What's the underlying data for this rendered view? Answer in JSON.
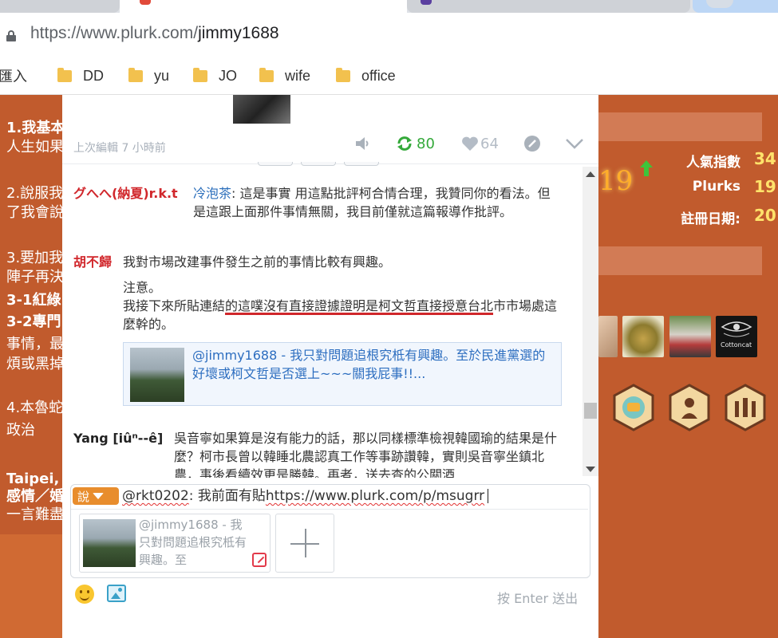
{
  "browser": {
    "url_host": "https://www.plurk.com/",
    "url_path": "jimmy1688",
    "bookmarks": [
      {
        "label": "匯入",
        "icon": "apps-icon"
      },
      {
        "label": "DD",
        "icon": "folder-icon"
      },
      {
        "label": "yu",
        "icon": "folder-icon"
      },
      {
        "label": "JO",
        "icon": "folder-icon"
      },
      {
        "label": "wife",
        "icon": "folder-icon"
      },
      {
        "label": "office",
        "icon": "folder-icon"
      }
    ]
  },
  "background_page": {
    "left_lines": [
      {
        "text": "1.我基本",
        "bold": true
      },
      {
        "text": "人生如果",
        "bold": false
      },
      {
        "text": "",
        "bold": false
      },
      {
        "text": "2.說服我",
        "bold": false
      },
      {
        "text": "了我會說",
        "bold": false
      },
      {
        "text": "",
        "bold": false
      },
      {
        "text": "3.要加我",
        "bold": false
      },
      {
        "text": "陣子再決",
        "bold": false
      },
      {
        "text": "3-1紅綠",
        "bold": true
      },
      {
        "text": "3-2專門",
        "bold": true
      },
      {
        "text": "事情，最",
        "bold": false
      },
      {
        "text": "煩或黑掉",
        "bold": false
      },
      {
        "text": "",
        "bold": false
      },
      {
        "text": "4.本魯蛇",
        "bold": false
      },
      {
        "text": "政治",
        "bold": false
      },
      {
        "text": "",
        "bold": false
      },
      {
        "text": "Taipei,",
        "bold": true
      },
      {
        "text": "感情／婚",
        "bold": true
      },
      {
        "text": "一言難盡",
        "bold": false
      }
    ],
    "karma": "19",
    "stats": [
      {
        "label": "人氣指數",
        "value": "34"
      },
      {
        "label": "Plurks",
        "value": "19"
      },
      {
        "label": "註冊日期:",
        "value": "20"
      }
    ],
    "friend_avatars": [
      "cat-avatar",
      "bird-avatar",
      "cyclists-avatar",
      "cottoncat-avatar"
    ],
    "friend_avatar_caption": "Cottoncat",
    "badges": [
      "chat-badge-icon",
      "keyhole-badge-icon",
      "group-badge-icon"
    ]
  },
  "plurk": {
    "edited_text": "上次編輯 7 小時前",
    "replurk_count": "80",
    "like_count": "64"
  },
  "responses": [
    {
      "author": "グへへ(納夏)r.k.t",
      "mention": "冷泡茶",
      "text": ": 這是事實 用這點批評柯合情合理，我贊同你的看法。但是這跟上面那件事情無關，我目前僅就這篇報導作批評。"
    },
    {
      "author": "胡不歸",
      "text": "我對市場改建事件發生之前的事情比較有興趣。",
      "note_line1": "注意。",
      "note_prefix": "我接下來所貼連結",
      "note_underlined": "的這噗沒有直接證據證明是柯文哲直接授意台北",
      "note_suffix": "市市場處這麼幹的。",
      "card_text": "@jimmy1688 - 我只對問題追根究柢有興趣。至於民進黨選的好壞或柯文哲是否選上~~~關我屁事!!..."
    },
    {
      "author": "Yang [iûⁿ--ê]",
      "text": "吳音寧如果算是沒有能力的話，那以同樣標準檢視韓國瑜的結果是什麼？柯市長曾以韓睡北農認真工作等事跡讚韓，實則吳音寧坐鎮北農，事後看續效更是勝韓。再者，送去查的公關酒"
    }
  ],
  "composer": {
    "qualifier": "說",
    "mention": "@rkt0202",
    "text_before_link": ": 我前面有貼",
    "link": "https://www.plurk.com/p/msugrr",
    "attachment_text": "@jimmy1688 - 我只對問題追根究柢有興趣。至",
    "hint": "按 Enter 送出"
  }
}
